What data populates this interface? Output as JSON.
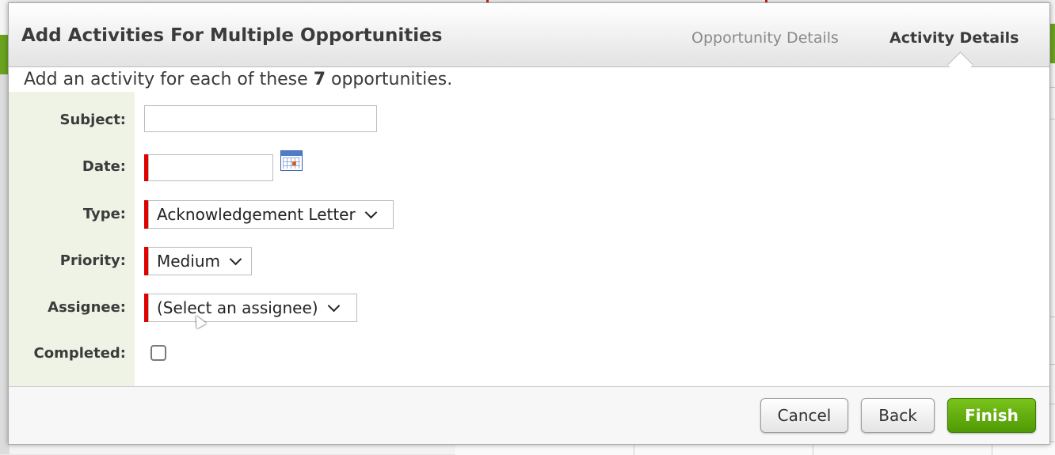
{
  "dialog": {
    "title": "Add Activities For Multiple Opportunities",
    "steps": [
      {
        "label": "Opportunity Details",
        "active": false
      },
      {
        "label": "Activity Details",
        "active": true
      }
    ],
    "intro_prefix": "Add an activity for each of these",
    "intro_count": "7",
    "intro_suffix": "opportunities."
  },
  "form": {
    "subject": {
      "label": "Subject:",
      "value": "",
      "required": false
    },
    "date": {
      "label": "Date:",
      "value": "",
      "required": true,
      "icon": "calendar-icon"
    },
    "type": {
      "label": "Type:",
      "value": "Acknowledgement Letter",
      "required": true
    },
    "priority": {
      "label": "Priority:",
      "value": "Medium",
      "required": true
    },
    "assignee": {
      "label": "Assignee:",
      "value": "(Select an assignee)",
      "required": true
    },
    "completed": {
      "label": "Completed:",
      "checked": false
    }
  },
  "footer": {
    "cancel_label": "Cancel",
    "back_label": "Back",
    "finish_label": "Finish"
  },
  "colors": {
    "required_marker": "#e00000",
    "finish_button": "#5aa80b",
    "label_column": "#eef3e6"
  }
}
